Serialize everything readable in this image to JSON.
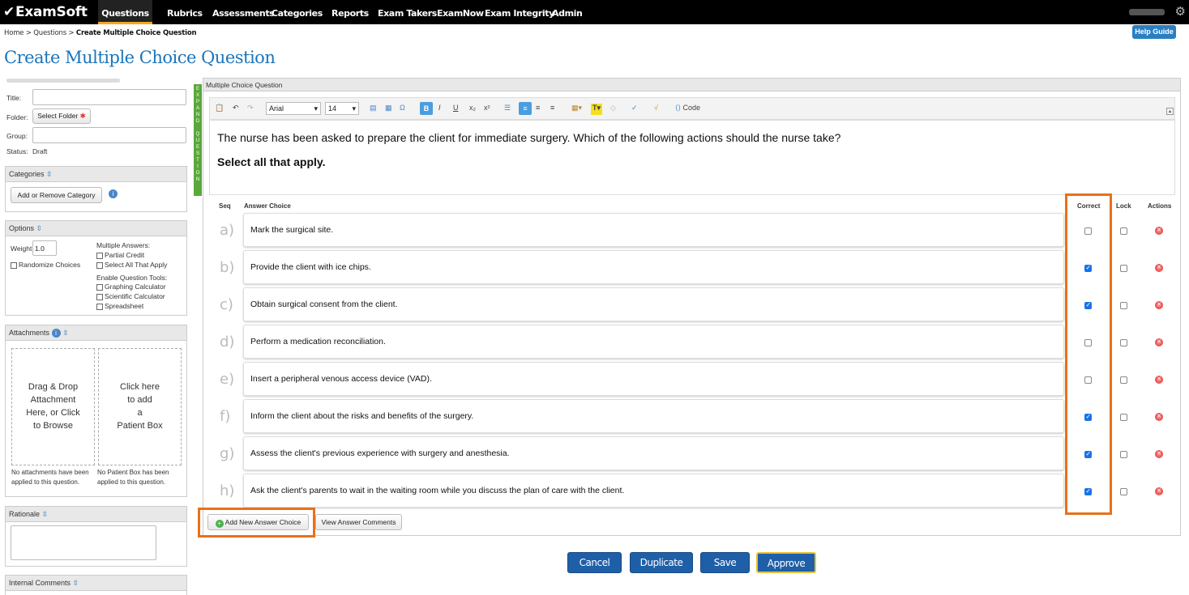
{
  "app": {
    "logo": "ExamSoft"
  },
  "nav": {
    "items": [
      "Questions",
      "Rubrics",
      "Assessments",
      "Categories",
      "Reports",
      "Exam Takers",
      "ExamNow",
      "Exam Integrity",
      "Admin"
    ]
  },
  "breadcrumb": {
    "home": "Home",
    "sep": ">",
    "questions": "Questions",
    "current": "Create Multiple Choice Question"
  },
  "help_label": "Help Guide",
  "page_title": "Create Multiple Choice Question",
  "form": {
    "title_label": "Title:",
    "folder_label": "Folder:",
    "select_folder": "Select Folder",
    "group_label": "Group:",
    "status_label": "Status:",
    "status_value": "Draft"
  },
  "categories": {
    "header": "Categories",
    "add_button": "Add or Remove Category"
  },
  "options": {
    "header": "Options",
    "weight_label": "Weight:",
    "weight_value": "1.0",
    "randomize": "Randomize Choices",
    "multiple_answers": "Multiple Answers:",
    "partial_credit": "Partial Credit",
    "select_all": "Select All That Apply",
    "tools_label": "Enable Question Tools:",
    "graphing": "Graphing Calculator",
    "scientific": "Scientific Calculator",
    "spreadsheet": "Spreadsheet"
  },
  "attachments": {
    "header": "Attachments",
    "drop_text": [
      "Drag & Drop",
      "Attachment",
      "Here, or Click",
      "to Browse"
    ],
    "patient_text": [
      "Click here",
      "to add",
      "a",
      "Patient Box"
    ],
    "no_attach": [
      "No attachments have been",
      "applied to this question."
    ],
    "no_patient": [
      "No Patient Box has been",
      "applied to this question."
    ]
  },
  "rationale": {
    "header": "Rationale"
  },
  "internal_comments": {
    "header": "Internal Comments"
  },
  "question": {
    "header": "Multiple Choice Question",
    "expand_label": [
      "E",
      "X",
      "P",
      "A",
      "N",
      "D",
      "",
      "Q",
      "U",
      "E",
      "S",
      "T",
      "I",
      "O",
      "N"
    ],
    "font": "Arial",
    "size": "14",
    "code_label": "Code",
    "stem": "The nurse has been asked to prepare the client for immediate surgery. Which of the following actions should the nurse take?",
    "instruction": "Select all that apply."
  },
  "columns": {
    "seq": "Seq",
    "answer": "Answer Choice",
    "correct": "Correct",
    "lock": "Lock",
    "actions": "Actions"
  },
  "answers": [
    {
      "seq": "a)",
      "text": "Mark the surgical site.",
      "correct": false
    },
    {
      "seq": "b)",
      "text": "Provide the client with ice chips.",
      "correct": true
    },
    {
      "seq": "c)",
      "text": "Obtain surgical consent from the client.",
      "correct": true
    },
    {
      "seq": "d)",
      "text": "Perform a medication reconciliation.",
      "correct": false
    },
    {
      "seq": "e)",
      "text": "Insert a peripheral venous access device (VAD).",
      "correct": false
    },
    {
      "seq": "f)",
      "text": "Inform the client about the risks and benefits of the surgery.",
      "correct": true
    },
    {
      "seq": "g)",
      "text": "Assess the client's previous experience with surgery and anesthesia.",
      "correct": true
    },
    {
      "seq": "h)",
      "text": "Ask the client's parents to wait in the waiting room while you discuss the plan of care with the client.",
      "correct": true
    }
  ],
  "add_answer": "Add New Answer Choice",
  "view_comments": "View Answer Comments",
  "actions": {
    "cancel": "Cancel",
    "duplicate": "Duplicate",
    "save": "Save",
    "approve": "Approve"
  },
  "colors": {
    "accent": "#1a75bb",
    "highlight": "#e8711a",
    "nav_bg": "#000000",
    "button": "#1f5fa8"
  }
}
